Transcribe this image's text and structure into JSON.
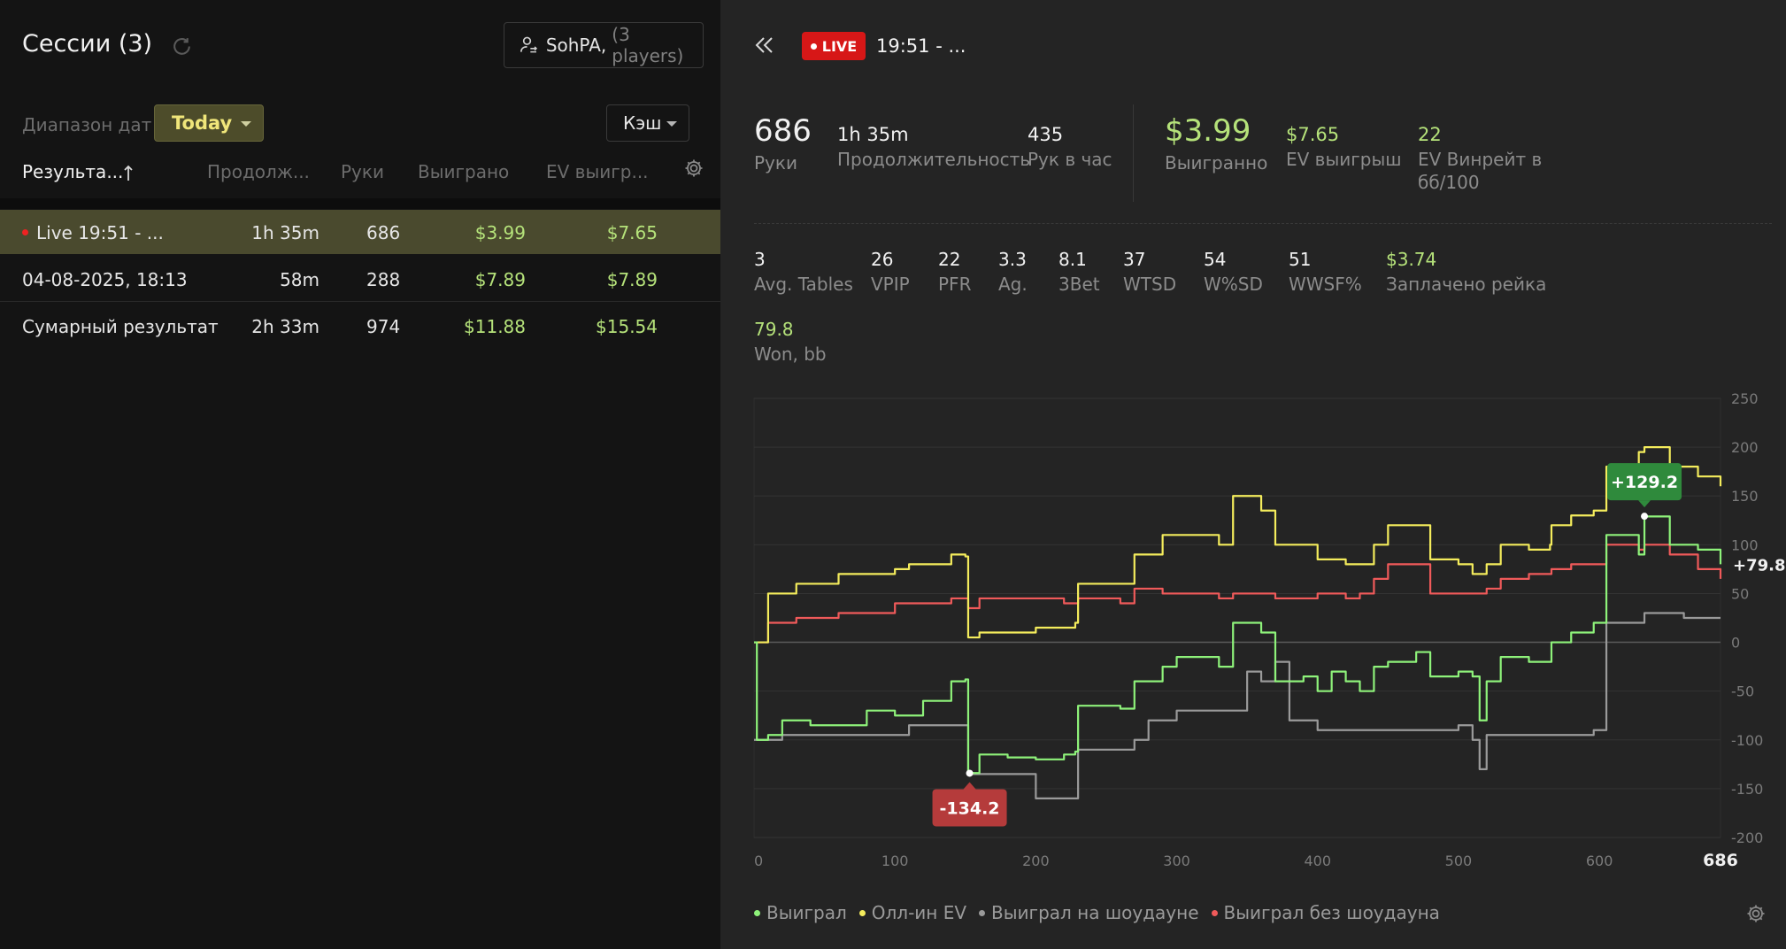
{
  "left": {
    "title": "Сессии (3)",
    "player_name": "SohPA,",
    "player_count": "(3 players)",
    "date_range_label": "Диапазон дат",
    "date_range_value": "Today",
    "game_type": "Кэш",
    "columns": [
      "Результа...",
      "Продолж...",
      "Руки",
      "Выиграно",
      "EV выигр..."
    ],
    "rows": [
      {
        "name": "Live 19:51 - ...",
        "duration": "1h 35m",
        "hands": "686",
        "won": "$3.99",
        "ev": "$7.65",
        "live": true,
        "selected": true
      },
      {
        "name": "04-08-2025, 18:13",
        "duration": "58m",
        "hands": "288",
        "won": "$7.89",
        "ev": "$7.89"
      },
      {
        "name": "Сумарный результат",
        "duration": "2h 33m",
        "hands": "974",
        "won": "$11.88",
        "ev": "$15.54"
      }
    ]
  },
  "right": {
    "live_label": "LIVE",
    "session_title": "19:51 - ...",
    "stats_top": [
      {
        "value": "686",
        "label": "Руки"
      },
      {
        "value": "1h 35m",
        "label": "Продолжительность"
      },
      {
        "value": "435",
        "label": "Рук в час"
      },
      {
        "value": "$3.99",
        "label": "Выигранно"
      },
      {
        "value": "$7.65",
        "label": "EV выигрыш"
      },
      {
        "value": "22",
        "label": "EV Винрейт в",
        "label2": "бб/100"
      }
    ],
    "stats_mid": [
      {
        "value": "3",
        "label": "Avg. Tables"
      },
      {
        "value": "26",
        "label": "VPIP"
      },
      {
        "value": "22",
        "label": "PFR"
      },
      {
        "value": "3.3",
        "label": "Ag."
      },
      {
        "value": "8.1",
        "label": "3Bet"
      },
      {
        "value": "37",
        "label": "WTSD"
      },
      {
        "value": "54",
        "label": "W%SD"
      },
      {
        "value": "51",
        "label": "WWSF%"
      },
      {
        "value": "$3.74",
        "label": "Заплачено рейка"
      }
    ],
    "stats_bottom": [
      {
        "value": "79.8",
        "label": "Won, bb"
      }
    ]
  },
  "colors": {
    "accent_green": "#b5e27a",
    "live_red": "#d71717",
    "line_won": "#8ef27a",
    "line_allin_ev": "#f4ec5c",
    "line_showdown": "#9a9a9a",
    "line_non_showdown": "#f05a5a"
  },
  "chart_data": {
    "type": "line",
    "xlim": [
      0,
      686
    ],
    "ylim": [
      -200,
      250
    ],
    "x_ticks": [
      0,
      100,
      200,
      300,
      400,
      500,
      600
    ],
    "x_end_label": "686",
    "y_ticks": [
      250,
      200,
      150,
      100,
      50,
      0,
      -50,
      -100,
      -150,
      -200
    ],
    "grid": true,
    "legend_placement": "bottom-left",
    "max_annotation": {
      "x": 632,
      "y": 129.2,
      "label": "+129.2"
    },
    "min_annotation": {
      "x": 153,
      "y": -134.2,
      "label": "-134.2"
    },
    "end_label": "+79.8",
    "series": [
      {
        "name": "Выиграл",
        "color": "#8ef27a",
        "points": [
          [
            0,
            0
          ],
          [
            2,
            -100
          ],
          [
            10,
            -95
          ],
          [
            20,
            -80
          ],
          [
            40,
            -85
          ],
          [
            60,
            -85
          ],
          [
            80,
            -70
          ],
          [
            100,
            -75
          ],
          [
            120,
            -60
          ],
          [
            140,
            -40
          ],
          [
            150,
            -38
          ],
          [
            152,
            -134
          ],
          [
            160,
            -115
          ],
          [
            180,
            -118
          ],
          [
            200,
            -120
          ],
          [
            220,
            -115
          ],
          [
            228,
            -112
          ],
          [
            230,
            -65
          ],
          [
            260,
            -68
          ],
          [
            270,
            -40
          ],
          [
            290,
            -25
          ],
          [
            300,
            -15
          ],
          [
            330,
            -25
          ],
          [
            340,
            20
          ],
          [
            360,
            10
          ],
          [
            370,
            -40
          ],
          [
            390,
            -35
          ],
          [
            400,
            -50
          ],
          [
            410,
            -30
          ],
          [
            420,
            -40
          ],
          [
            430,
            -50
          ],
          [
            440,
            -25
          ],
          [
            450,
            -20
          ],
          [
            470,
            -10
          ],
          [
            480,
            -35
          ],
          [
            500,
            -30
          ],
          [
            510,
            -35
          ],
          [
            515,
            -80
          ],
          [
            520,
            -40
          ],
          [
            530,
            -15
          ],
          [
            550,
            -20
          ],
          [
            565,
            -20
          ],
          [
            566,
            0
          ],
          [
            580,
            10
          ],
          [
            596,
            20
          ],
          [
            605,
            110
          ],
          [
            620,
            110
          ],
          [
            628,
            90
          ],
          [
            632,
            129
          ],
          [
            650,
            100
          ],
          [
            670,
            95
          ],
          [
            686,
            80
          ]
        ]
      },
      {
        "name": "Олл-ин EV",
        "color": "#f4ec5c",
        "points": [
          [
            0,
            0
          ],
          [
            10,
            50
          ],
          [
            30,
            60
          ],
          [
            60,
            70
          ],
          [
            100,
            75
          ],
          [
            110,
            80
          ],
          [
            140,
            90
          ],
          [
            150,
            88
          ],
          [
            152,
            5
          ],
          [
            160,
            10
          ],
          [
            200,
            15
          ],
          [
            220,
            15
          ],
          [
            228,
            20
          ],
          [
            230,
            60
          ],
          [
            260,
            60
          ],
          [
            270,
            90
          ],
          [
            290,
            110
          ],
          [
            300,
            110
          ],
          [
            330,
            100
          ],
          [
            340,
            150
          ],
          [
            360,
            135
          ],
          [
            370,
            100
          ],
          [
            390,
            100
          ],
          [
            400,
            85
          ],
          [
            420,
            80
          ],
          [
            430,
            80
          ],
          [
            440,
            100
          ],
          [
            450,
            120
          ],
          [
            470,
            120
          ],
          [
            480,
            85
          ],
          [
            500,
            80
          ],
          [
            510,
            70
          ],
          [
            520,
            80
          ],
          [
            530,
            100
          ],
          [
            550,
            95
          ],
          [
            565,
            100
          ],
          [
            566,
            120
          ],
          [
            580,
            130
          ],
          [
            596,
            135
          ],
          [
            605,
            180
          ],
          [
            620,
            180
          ],
          [
            628,
            195
          ],
          [
            632,
            200
          ],
          [
            650,
            180
          ],
          [
            670,
            170
          ],
          [
            686,
            160
          ]
        ]
      },
      {
        "name": "Выиграл на шоудауне",
        "color": "#9a9a9a",
        "points": [
          [
            0,
            -100
          ],
          [
            20,
            -95
          ],
          [
            100,
            -95
          ],
          [
            110,
            -85
          ],
          [
            150,
            -85
          ],
          [
            152,
            -135
          ],
          [
            160,
            -135
          ],
          [
            200,
            -160
          ],
          [
            228,
            -160
          ],
          [
            230,
            -110
          ],
          [
            270,
            -100
          ],
          [
            280,
            -80
          ],
          [
            300,
            -70
          ],
          [
            340,
            -70
          ],
          [
            350,
            -30
          ],
          [
            360,
            -40
          ],
          [
            370,
            -20
          ],
          [
            380,
            -80
          ],
          [
            400,
            -90
          ],
          [
            450,
            -90
          ],
          [
            500,
            -85
          ],
          [
            510,
            -100
          ],
          [
            515,
            -130
          ],
          [
            520,
            -95
          ],
          [
            550,
            -95
          ],
          [
            596,
            -90
          ],
          [
            605,
            20
          ],
          [
            630,
            20
          ],
          [
            632,
            30
          ],
          [
            650,
            30
          ],
          [
            660,
            25
          ],
          [
            686,
            25
          ]
        ]
      },
      {
        "name": "Выиграл без шоудауна",
        "color": "#f05a5a",
        "points": [
          [
            0,
            0
          ],
          [
            10,
            20
          ],
          [
            30,
            25
          ],
          [
            60,
            30
          ],
          [
            100,
            40
          ],
          [
            140,
            45
          ],
          [
            150,
            45
          ],
          [
            152,
            35
          ],
          [
            160,
            45
          ],
          [
            200,
            45
          ],
          [
            220,
            40
          ],
          [
            228,
            40
          ],
          [
            230,
            45
          ],
          [
            260,
            40
          ],
          [
            270,
            55
          ],
          [
            290,
            50
          ],
          [
            300,
            50
          ],
          [
            330,
            45
          ],
          [
            340,
            50
          ],
          [
            360,
            50
          ],
          [
            370,
            45
          ],
          [
            390,
            45
          ],
          [
            400,
            50
          ],
          [
            420,
            45
          ],
          [
            430,
            50
          ],
          [
            440,
            65
          ],
          [
            450,
            80
          ],
          [
            470,
            80
          ],
          [
            480,
            50
          ],
          [
            500,
            50
          ],
          [
            510,
            50
          ],
          [
            520,
            55
          ],
          [
            530,
            65
          ],
          [
            550,
            70
          ],
          [
            565,
            70
          ],
          [
            566,
            75
          ],
          [
            580,
            80
          ],
          [
            596,
            80
          ],
          [
            605,
            100
          ],
          [
            620,
            100
          ],
          [
            628,
            95
          ],
          [
            632,
            100
          ],
          [
            650,
            90
          ],
          [
            670,
            75
          ],
          [
            686,
            65
          ]
        ]
      }
    ]
  }
}
